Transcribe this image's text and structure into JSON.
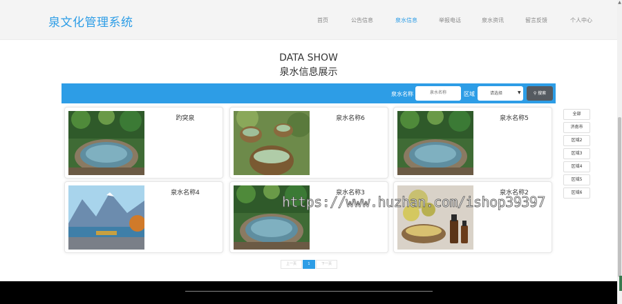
{
  "header": {
    "brand": "泉文化管理系统",
    "nav": [
      "首页",
      "公告信息",
      "泉水信息",
      "举报电话",
      "泉水资讯",
      "留言反馈",
      "个人中心"
    ],
    "active_nav": "泉水信息"
  },
  "section": {
    "title_en": "DATA SHOW",
    "title_cn": "泉水信息展示"
  },
  "search": {
    "name_label": "泉水名称",
    "name_placeholder": "泉水名称",
    "region_label": "区域",
    "region_selected": "请选择",
    "button_label": "搜索"
  },
  "cards": [
    {
      "title": "趵突泉",
      "image": "round-pool-garden"
    },
    {
      "title": "泉水名称6",
      "image": "pots-pools"
    },
    {
      "title": "泉水名称5",
      "image": "round-pool-garden"
    },
    {
      "title": "泉水名称4",
      "image": "mountain-lake"
    },
    {
      "title": "泉水名称3",
      "image": "round-pool-garden"
    },
    {
      "title": "泉水名称2",
      "image": "flowers-bottles"
    }
  ],
  "filters": [
    "全部",
    "济南市",
    "区域2",
    "区域3",
    "区域4",
    "区域5",
    "区域6"
  ],
  "pagination": {
    "prev": "上一页",
    "current": "1",
    "next": "下一页"
  },
  "watermark": "https://www.huzhan.com/ishop39397",
  "colors": {
    "accent": "#2d9de6",
    "footer": "#000000",
    "button": "#555a60"
  }
}
